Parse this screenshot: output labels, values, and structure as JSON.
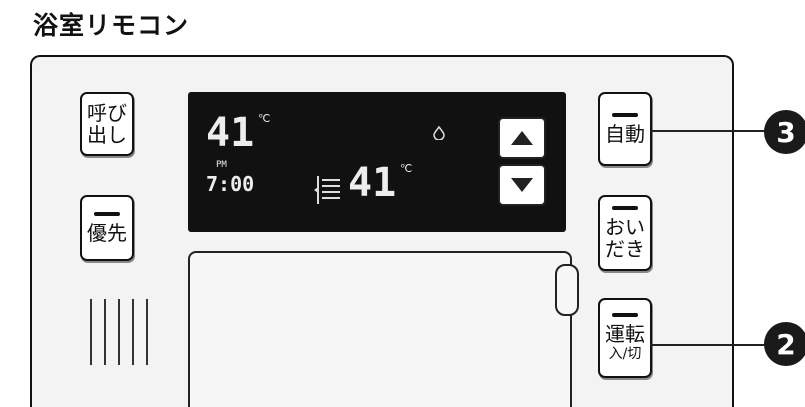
{
  "page_title": "浴室リモコン",
  "buttons": {
    "call": {
      "line1": "呼び",
      "line2": "出し"
    },
    "priority": {
      "label": "優先"
    },
    "auto": {
      "label": "自動"
    },
    "reheat": {
      "line1": "おい",
      "line2": "だき"
    },
    "power": {
      "line1": "運転",
      "line2": "入/切"
    }
  },
  "display": {
    "temperature_main": "41",
    "temperature_unit": "℃",
    "period": "PM",
    "clock": "7:00",
    "temperature_set": "41",
    "temperature_set_unit": "℃"
  },
  "callouts": {
    "auto": "3",
    "power": "2"
  }
}
